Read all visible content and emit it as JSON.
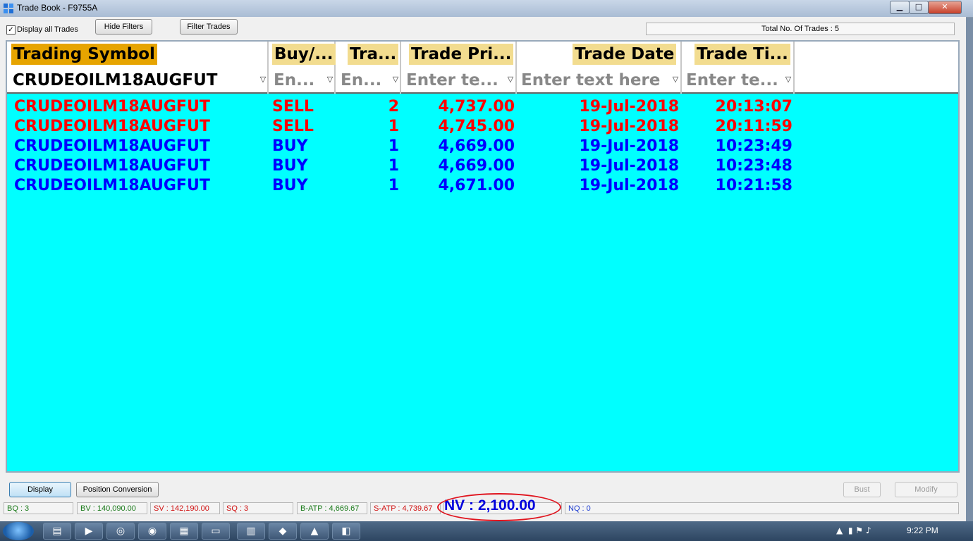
{
  "window": {
    "title": "Trade Book - F9755A",
    "min": "▁",
    "max": "□",
    "close": "✕"
  },
  "toolbar": {
    "display_all_checked": "✓",
    "display_all_label": "Display all Trades",
    "hide_filters": "Hide Filters",
    "filter_trades": "Filter Trades",
    "total_trades": "Total No. Of Trades : 5"
  },
  "columns": [
    {
      "header": "Trading Symbol",
      "filter": "CRUDEOILM18AUGFUT"
    },
    {
      "header": "Buy/...",
      "filter": "En..."
    },
    {
      "header": "Tra...",
      "filter": "En..."
    },
    {
      "header": "Trade Pri...",
      "filter": "Enter te..."
    },
    {
      "header": "Trade Date",
      "filter": "Enter text here"
    },
    {
      "header": "Trade Ti...",
      "filter": "Enter te..."
    }
  ],
  "filter_icon": "funnel-icon",
  "trades": [
    {
      "symbol": "CRUDEOILM18AUGFUT",
      "side": "SELL",
      "qty": "2",
      "price": "4,737.00",
      "date": "19-Jul-2018",
      "time": "20:13:07"
    },
    {
      "symbol": "CRUDEOILM18AUGFUT",
      "side": "SELL",
      "qty": "1",
      "price": "4,745.00",
      "date": "19-Jul-2018",
      "time": "20:11:59"
    },
    {
      "symbol": "CRUDEOILM18AUGFUT",
      "side": "BUY",
      "qty": "1",
      "price": "4,669.00",
      "date": "19-Jul-2018",
      "time": "10:23:49"
    },
    {
      "symbol": "CRUDEOILM18AUGFUT",
      "side": "BUY",
      "qty": "1",
      "price": "4,669.00",
      "date": "19-Jul-2018",
      "time": "10:23:48"
    },
    {
      "symbol": "CRUDEOILM18AUGFUT",
      "side": "BUY",
      "qty": "1",
      "price": "4,671.00",
      "date": "19-Jul-2018",
      "time": "10:21:58"
    }
  ],
  "colors": {
    "grid_bg": "#00ffff",
    "sell": "#ff0000",
    "buy": "#0000ff",
    "header_bg": "#f2dc8f",
    "nv_ring": "#e0141e"
  },
  "actions": {
    "display": "Display",
    "position_conversion": "Position Conversion",
    "bust": "Bust",
    "modify": "Modify"
  },
  "status": {
    "bq": "BQ : 3",
    "bv": "BV : 140,090.00",
    "sv": "SV : 142,190.00",
    "sq": "SQ : 3",
    "batp": "B-ATP : 4,669.67",
    "satp": "S-ATP : 4,739.67",
    "nv": "NV : 2,100.00",
    "nq": "NQ : 0"
  },
  "taskbar": {
    "clock": "9:22 PM",
    "tray_up": "▲"
  }
}
